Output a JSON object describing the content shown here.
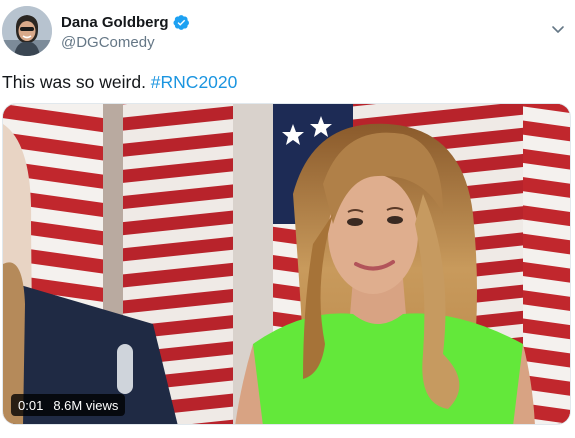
{
  "author": {
    "display_name": "Dana Goldberg",
    "handle": "@DGComedy",
    "verified": true,
    "verified_icon": "verified-badge-icon",
    "avatar_icon": "avatar"
  },
  "menu": {
    "icon": "chevron-down-icon"
  },
  "tweet": {
    "text": "This was so weird. ",
    "hashtag": "#RNC2020"
  },
  "video": {
    "time": "0:01",
    "views": "8.6M views"
  },
  "colors": {
    "link": "#1b95e0",
    "verified": "#1da1f2",
    "secondary_text": "#657786",
    "dress": "#63e83a"
  }
}
